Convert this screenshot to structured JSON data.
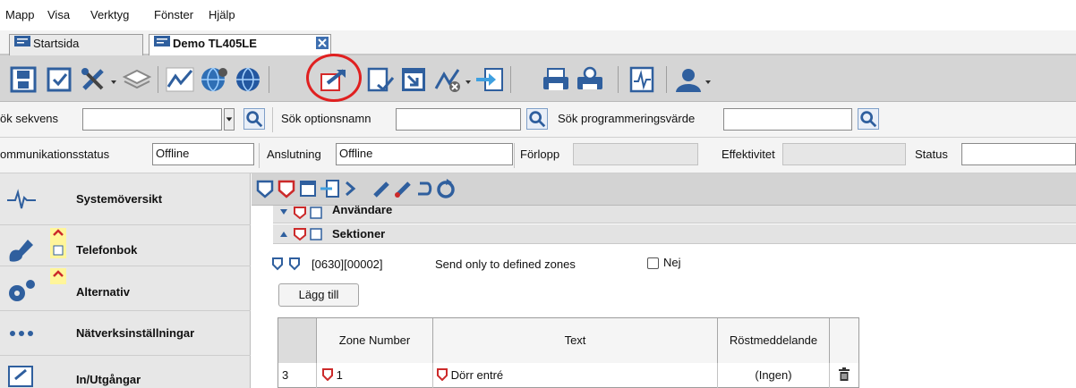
{
  "menu": {
    "items": [
      "Mapp",
      "Visa",
      "Verktyg",
      "Fönster",
      "Hjälp"
    ]
  },
  "tabs": [
    {
      "label": "Startsida",
      "active": false
    },
    {
      "label": "Demo TL405LE",
      "active": true
    }
  ],
  "search": {
    "sequence_label": "ök sekvens",
    "sequence_value": "",
    "option_label": "Sök optionsnamn",
    "option_value": "",
    "value_label": "Sök programmeringsvärde",
    "value_value": ""
  },
  "status": {
    "comm_label": "ommunikationsstatus",
    "comm_value": "Offline",
    "connection_label": "Anslutning",
    "connection_value": "Offline",
    "progress_label": "Förlopp",
    "efficiency_label": "Effektivitet",
    "status_label": "Status"
  },
  "sidebar": {
    "items": [
      {
        "label": "Systemöversikt",
        "icon": "heartbeat-icon"
      },
      {
        "label": "Telefonbok",
        "icon": "phonebook-icon"
      },
      {
        "label": "Alternativ",
        "icon": "gears-icon"
      },
      {
        "label": "Nätverksinställningar",
        "icon": "network-dots-icon"
      },
      {
        "label": "In/Utgångar",
        "icon": "io-icon"
      }
    ]
  },
  "content": {
    "section_users": "Användare",
    "section_sections": "Sektioner",
    "option_code": "[0630][00002]",
    "option_name": "Send only to defined zones",
    "option_state": "Nej",
    "add_button": "Lägg till",
    "grid": {
      "columns": [
        "",
        "Zone Number",
        "Text",
        "Röstmeddelande",
        ""
      ],
      "rows": [
        {
          "index": "3",
          "zone": "1",
          "text": "Dörr entré",
          "voice": "(Ingen)"
        }
      ]
    }
  },
  "colors": {
    "accent_red": "#e02020",
    "toolbar_blue": "#2f5f9e",
    "toolbar_bg": "#d5d5d5"
  }
}
